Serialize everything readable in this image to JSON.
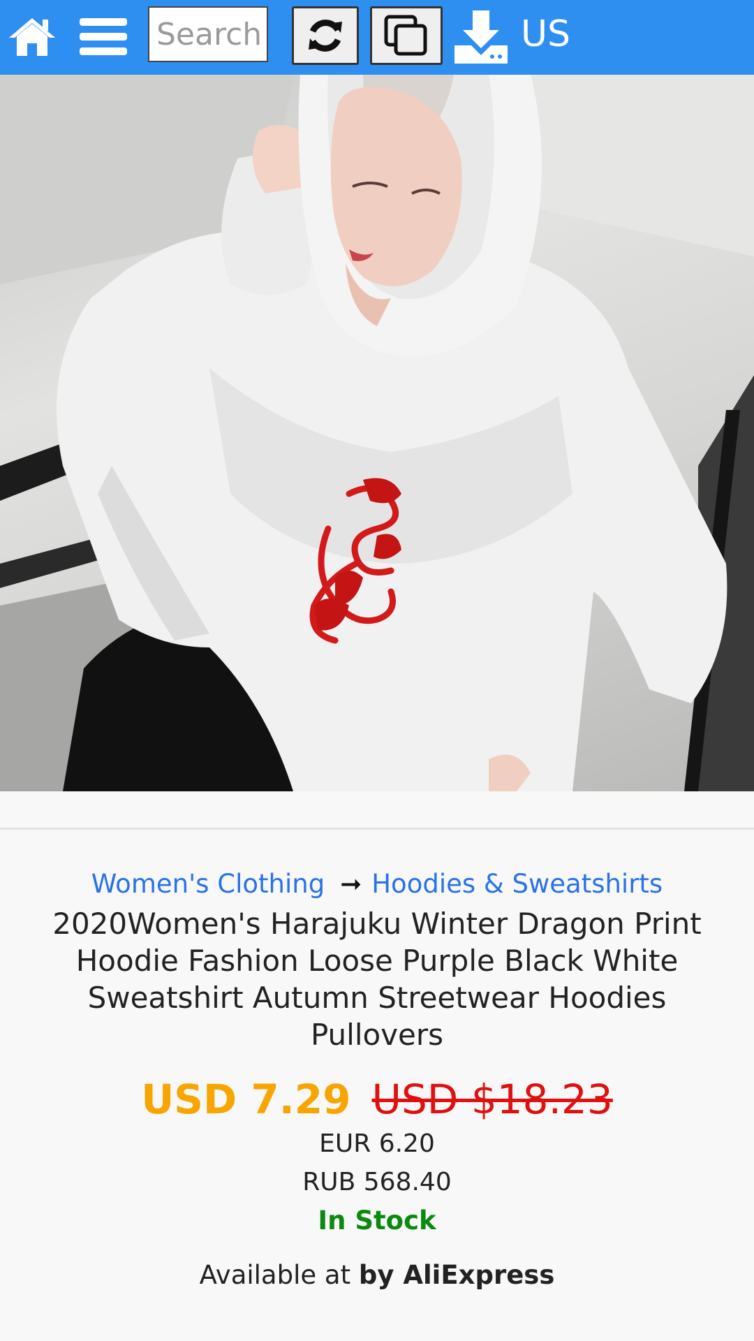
{
  "topbar": {
    "bg": "#2f8ff0",
    "icons": [
      "home-icon",
      "menu-icon",
      "refresh-icon",
      "copy-icon",
      "download-icon"
    ],
    "search_placeholder": "Search",
    "country": "US"
  },
  "product": {
    "image_alt": "Woman wearing white hoodie with red dragon print",
    "breadcrumb": {
      "category": "Women's Clothing",
      "separator": "➞",
      "subcategory": "Hoodies & Sweatshirts"
    },
    "title": "2020Women's Harajuku Winter Dragon Print Hoodie Fashion Loose Purple Black White Sweatshirt Autumn Streetwear Hoodies Pullovers",
    "price_current": "USD 7.29",
    "price_original": "USD $18.23",
    "price_eur": "EUR 6.20",
    "price_rub": "RUB 568.40",
    "stock_status": "In Stock",
    "available_prefix": "Available at",
    "available_store": "by AliExpress"
  },
  "colors": {
    "price_current": "#f7a500",
    "price_original": "#e01010",
    "in_stock": "#0b8a10",
    "link": "#2a72e8"
  }
}
